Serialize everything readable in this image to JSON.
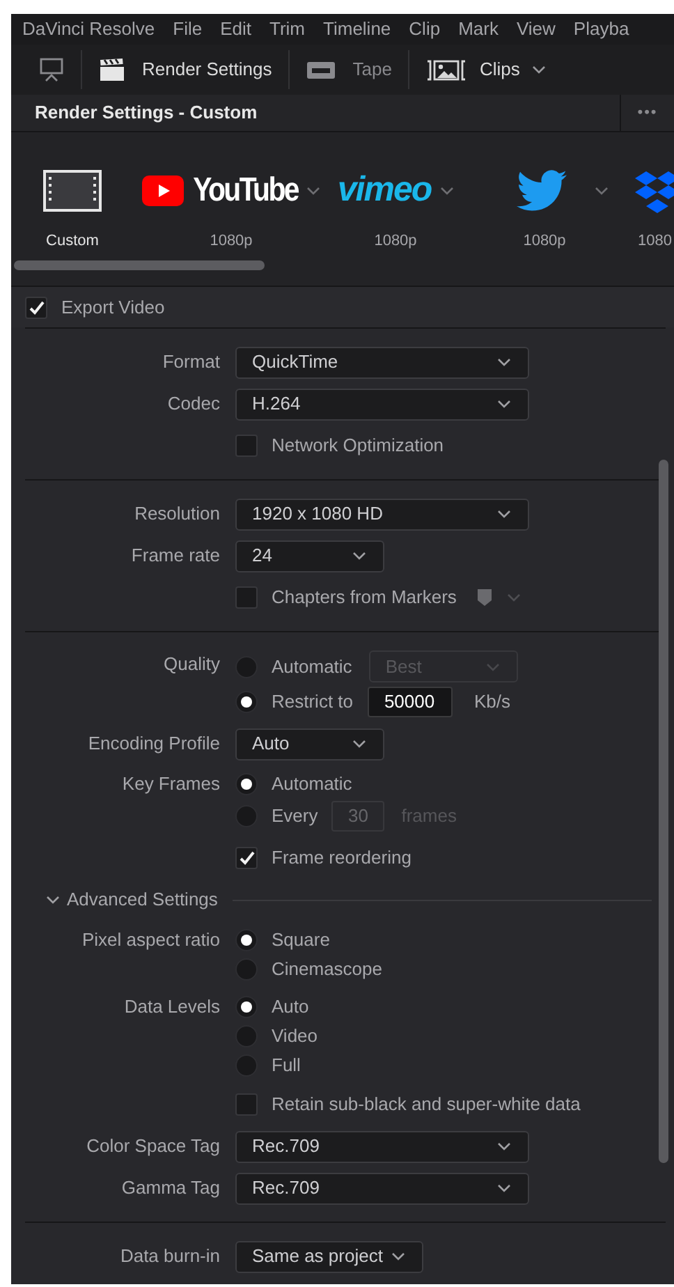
{
  "menu_bar": [
    "DaVinci Resolve",
    "File",
    "Edit",
    "Trim",
    "Timeline",
    "Clip",
    "Mark",
    "View",
    "Playba"
  ],
  "toolbar": [
    {
      "kind": "monitor",
      "disabled": false
    },
    {
      "kind": "clapper",
      "label": "Render Settings",
      "disabled": false
    },
    {
      "kind": "tape",
      "label": "Tape",
      "disabled": true
    },
    {
      "kind": "clips",
      "label": "Clips",
      "disabled": false
    }
  ],
  "panel": {
    "title": "Render Settings - Custom",
    "more": "•••"
  },
  "presets": [
    {
      "kind": "custom",
      "caption": "Custom",
      "selected": true
    },
    {
      "kind": "youtube",
      "logo": "YouTube",
      "caption": "1080p",
      "selected": false
    },
    {
      "kind": "vimeo",
      "logo": "vimeo",
      "caption": "1080p",
      "selected": false
    },
    {
      "kind": "twitter",
      "caption": "1080p",
      "selected": false
    },
    {
      "kind": "dropbox",
      "caption": "1080",
      "selected": false
    }
  ],
  "export_video": {
    "label": "Export Video",
    "checked": true
  },
  "sections": [
    {
      "rows": [
        {
          "kind": "select",
          "label": "Format",
          "value": "QuickTime"
        },
        {
          "kind": "select",
          "label": "Codec",
          "value": "H.264"
        },
        {
          "kind": "checkbox",
          "text": "Network Optimization",
          "checked": false
        }
      ]
    },
    {
      "rows": [
        {
          "kind": "select",
          "label": "Resolution",
          "value": "1920 x 1080 HD"
        },
        {
          "kind": "short_select",
          "label": "Frame rate",
          "value": "24"
        },
        {
          "kind": "marker_checkbox",
          "text": "Chapters from Markers",
          "checked": false
        }
      ]
    },
    {
      "rows": [
        {
          "kind": "radios",
          "label": "Quality",
          "options": [
            {
              "text": "Automatic",
              "selected": false,
              "kind": "select",
              "value": "Best",
              "disabled": true
            },
            {
              "text": "Restrict to",
              "selected": true,
              "kind": "input",
              "value": "50000",
              "unit": "Kb/s",
              "disabled": false
            }
          ]
        },
        {
          "kind": "short_select",
          "label": "Encoding Profile",
          "value": "Auto"
        },
        {
          "kind": "radios",
          "label": "Key Frames",
          "options": [
            {
              "text": "Automatic",
              "selected": true,
              "kind": "plain"
            },
            {
              "text": "Every",
              "selected": false,
              "kind": "input",
              "value": "30",
              "unit": "frames",
              "disabled": true
            }
          ]
        },
        {
          "kind": "checkbox",
          "text": "Frame reordering",
          "checked": true
        },
        {
          "kind": "heading",
          "text": "Advanced Settings",
          "expanded": true
        },
        {
          "kind": "radios",
          "label": "Pixel aspect ratio",
          "options": [
            {
              "text": "Square",
              "selected": true,
              "kind": "plain"
            },
            {
              "text": "Cinemascope",
              "selected": false,
              "kind": "plain"
            }
          ]
        },
        {
          "kind": "radios",
          "label": "Data Levels",
          "options": [
            {
              "text": "Auto",
              "selected": true,
              "kind": "plain"
            },
            {
              "text": "Video",
              "selected": false,
              "kind": "plain"
            },
            {
              "text": "Full",
              "selected": false,
              "kind": "plain"
            }
          ]
        },
        {
          "kind": "checkbox",
          "text": "Retain sub-black and super-white data",
          "checked": false
        },
        {
          "kind": "select",
          "label": "Color Space Tag",
          "value": "Rec.709"
        },
        {
          "kind": "select",
          "label": "Gamma Tag",
          "value": "Rec.709"
        }
      ]
    },
    {
      "rows": [
        {
          "kind": "auto_select",
          "label": "Data burn-in",
          "value": "Same as project"
        }
      ]
    }
  ]
}
